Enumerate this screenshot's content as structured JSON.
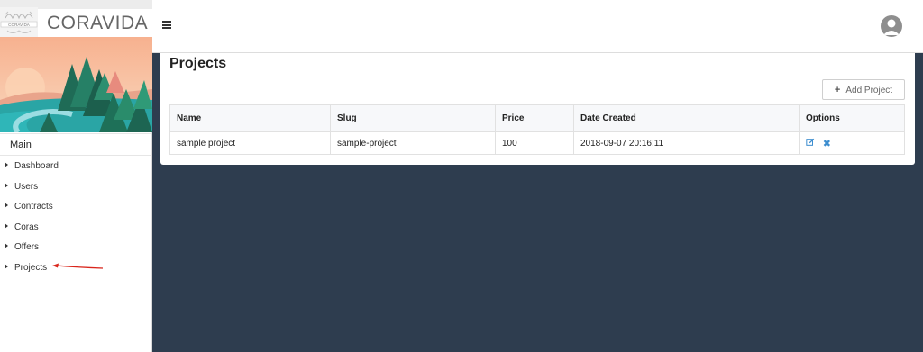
{
  "brand": {
    "name": "CORAVIDA",
    "logo_text": "CORAVIDA"
  },
  "sidebar": {
    "section_title": "Main",
    "items": [
      {
        "label": "Dashboard"
      },
      {
        "label": "Users"
      },
      {
        "label": "Contracts"
      },
      {
        "label": "Coras"
      },
      {
        "label": "Offers"
      },
      {
        "label": "Projects"
      }
    ]
  },
  "topbar": {
    "menu_icon": "hamburger-icon",
    "avatar_icon": "user-avatar-icon"
  },
  "page": {
    "title": "Projects",
    "add_button": "Add Project",
    "table": {
      "headers": [
        "Name",
        "Slug",
        "Price",
        "Date Created",
        "Options"
      ],
      "rows": [
        {
          "name": "sample project",
          "slug": "sample-project",
          "price": "100",
          "date": "2018-09-07 20:16:11"
        }
      ]
    }
  },
  "colors": {
    "content_bg": "#2e3d4f",
    "accent": "#3c8dcf",
    "annotation": "#d9261c"
  }
}
